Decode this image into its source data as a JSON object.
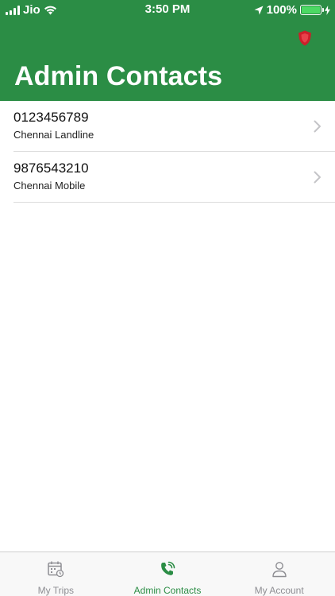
{
  "status_bar": {
    "carrier": "Jio",
    "time": "3:50 PM",
    "battery": "100%",
    "battery_level": 1.0
  },
  "header": {
    "title": "Admin Contacts",
    "icon": "shield-icon",
    "color": "#2b8d45"
  },
  "contacts": [
    {
      "number": "0123456789",
      "label": "Chennai Landline"
    },
    {
      "number": "9876543210",
      "label": "Chennai Mobile"
    }
  ],
  "tabs": [
    {
      "label": "My Trips",
      "icon": "calendar-icon",
      "active": false
    },
    {
      "label": "Admin Contacts",
      "icon": "phone-icon",
      "active": true
    },
    {
      "label": "My Account",
      "icon": "person-icon",
      "active": false
    }
  ],
  "colors": {
    "accent": "#2b8d45",
    "battery": "#4cd964",
    "shield": "#cc1f2a",
    "inactive_tab": "#8e8e93"
  }
}
